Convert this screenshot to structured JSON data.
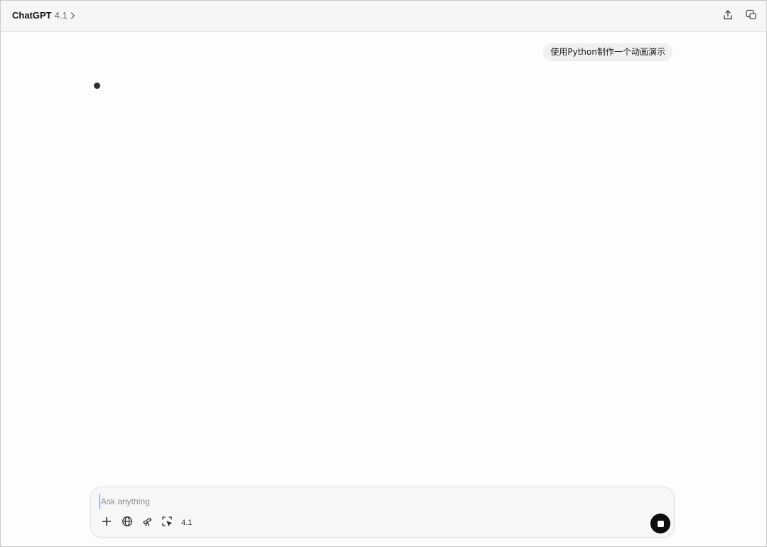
{
  "header": {
    "brand": "ChatGPT",
    "version": "4.1",
    "icons": {
      "model_chevron": "chevron-right-icon",
      "share": "share-icon",
      "temporary_chat": "temporary-chat-icon"
    }
  },
  "conversation": {
    "user_message": "使用Python制作一个动画演示",
    "assistant_state_icon": "typing-dot-icon"
  },
  "composer": {
    "placeholder": "Ask anything",
    "value": "",
    "tools": [
      {
        "icon": "plus-icon"
      },
      {
        "icon": "globe-icon"
      },
      {
        "icon": "telescope-icon"
      },
      {
        "icon": "select-cursor-icon"
      }
    ],
    "model_label": "4.1",
    "stop_icon": "stop-icon"
  },
  "colors": {
    "header_bg": "#f6f6f7",
    "bubble_bg": "#f0f0f2",
    "stop_button": "#0d0d0d",
    "caret": "#3b82f6"
  }
}
